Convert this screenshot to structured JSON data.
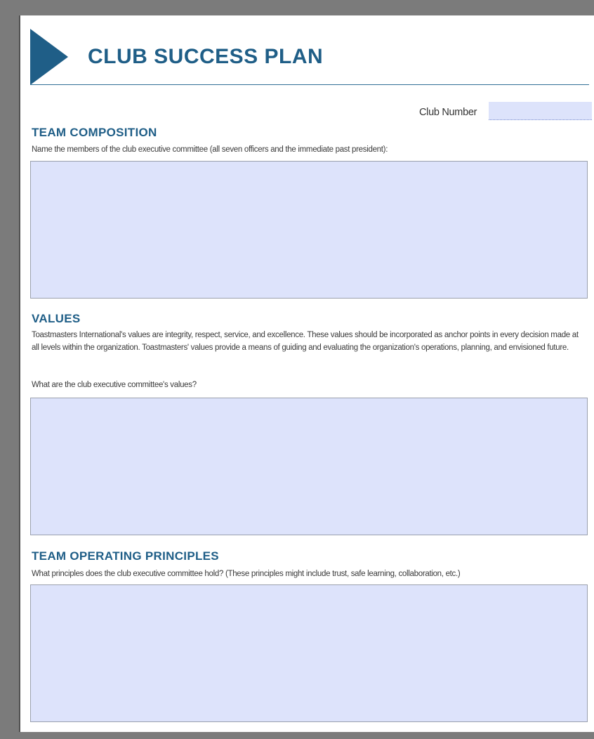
{
  "header": {
    "title": "CLUB SUCCESS PLAN",
    "accent_color": "#1f5e87",
    "mark_icon": "triangle-play-icon"
  },
  "club_number": {
    "label": "Club Number",
    "value": ""
  },
  "team_composition": {
    "title": "TEAM COMPOSITION",
    "instruction": "Name the members of the club executive committee (all seven officers and the immediate past president):",
    "value": ""
  },
  "values": {
    "title": "VALUES",
    "description": "Toastmasters International's values are integrity, respect, service, and excellence. These values should be incorporated as anchor points in every decision made at all levels within the organization. Toastmasters' values provide a means of guiding and evaluating the organization's operations, planning, and envisioned future.",
    "question": "What are the club executive committee's values?",
    "value": ""
  },
  "team_operating_principles": {
    "title": "TEAM OPERATING PRINCIPLES",
    "question": "What principles does the club executive committee hold? (These principles might include trust, safe learning, collaboration, etc.)",
    "value": ""
  },
  "field_color": "#dde3fb"
}
